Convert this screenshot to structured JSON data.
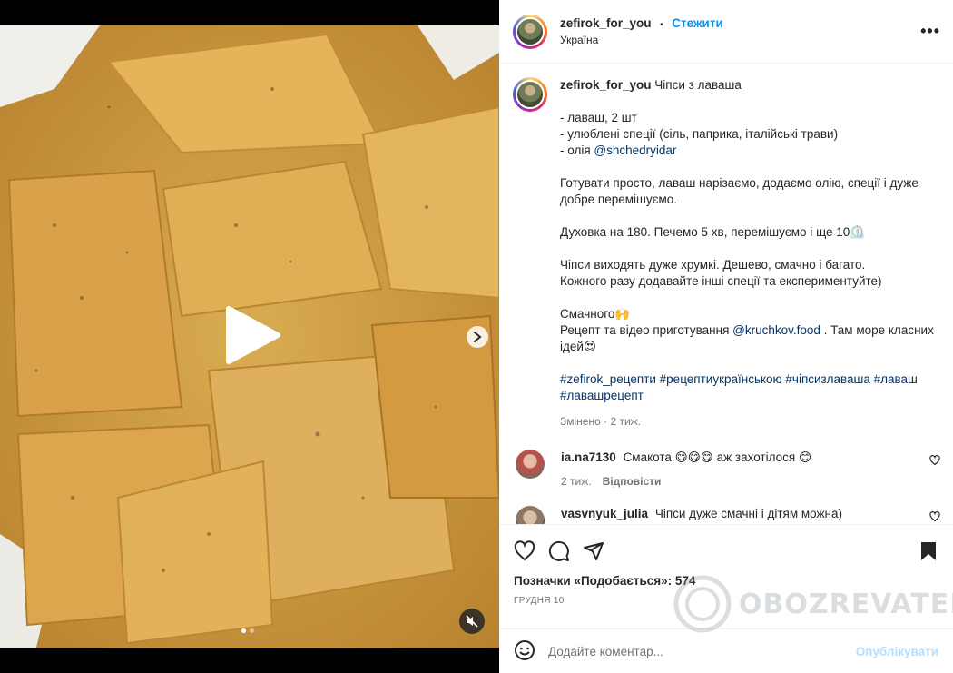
{
  "post": {
    "username": "zefirok_for_you",
    "follow_label": "Стежити",
    "location": "Україна",
    "more_label": "•••"
  },
  "caption": {
    "username": "zefirok_for_you",
    "title": "Чіпси з лаваша",
    "ingredients_line1": "- лаваш, 2 шт",
    "ingredients_line2": "- улюблені спеції (сіль, паприка, італійські трави)",
    "ingredients_line3_prefix": "- олія ",
    "ingredients_line3_link": "@shchedryidar",
    "paragraph_1": "Готувати просто, лаваш нарізаємо, додаємо олію, спеції і дуже добре перемішуємо.",
    "paragraph_2": "Духовка на 180. Печемо 5 хв, перемішуємо і ще 10⏲️",
    "paragraph_3": "Чіпси виходять дуже хрумкі. Дешево, смачно і багато.\nКожного разу додавайте інші спеції та експериментуйте)",
    "sign_off": "Смачного🙌",
    "credit_prefix": "Рецепт та відео приготування ",
    "credit_link": "@kruchkov.food",
    "credit_suffix": " . Там море класних ідей😍",
    "hashtags": "#zefirok_рецепти #рецептиукраїнською #чіпсизлаваша #лаваш #лавашрецепт",
    "edited_label": "Змінено",
    "edited_time": "2 тиж."
  },
  "comments": [
    {
      "username": "ia.na7130",
      "text": "Смакота 😋😋😋 аж захотілося 😊",
      "time": "2 тиж.",
      "reply_label": "Відповісти"
    },
    {
      "username": "vasvnyuk_julia",
      "text": "Чіпси дуже смачні і дітям можна)"
    }
  ],
  "stats": {
    "likes_label": "Позначки «Подобається»: 574",
    "date": "ГРУДНЯ 10"
  },
  "composer": {
    "placeholder": "Додайте коментар...",
    "publish_label": "Опублікувати"
  },
  "watermark": {
    "text": "OBOZREVATEL"
  },
  "colors": {
    "accent": "#0095f6",
    "link": "#00376b",
    "muted": "#737373",
    "publish_disabled": "#b2dffc"
  },
  "carousel": {
    "slides": 2,
    "current": 1
  }
}
